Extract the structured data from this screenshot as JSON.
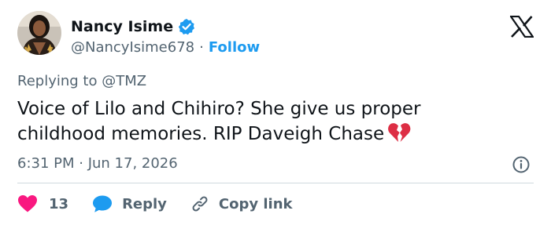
{
  "author": {
    "name": "Nancy Isime",
    "handle": "@NancyIsime678",
    "separator": "·",
    "follow_label": "Follow"
  },
  "tweet": {
    "replying_to": "Replying to @TMZ",
    "line1": "Voice of Lilo and Chihiro? She give us proper",
    "line2": "childhood memories. RIP Daveigh Chase",
    "emoji": "broken-heart",
    "timestamp": "6:31 PM · Jun 17, 2026"
  },
  "actions": {
    "like_count": "13",
    "reply_label": "Reply",
    "copy_link_label": "Copy link"
  },
  "colors": {
    "accent": "#1d9bf0",
    "secondary_text": "#536471",
    "primary_text": "#0f1419",
    "like_pink": "#f91880",
    "broken_heart_red": "#dd2e44",
    "divider": "#cfd9de"
  },
  "icons": {
    "brand": "x-logo-icon",
    "verified": "verified-badge-icon",
    "info": "info-icon",
    "like": "heart-icon",
    "reply": "speech-bubble-icon",
    "copy_link": "link-icon"
  }
}
